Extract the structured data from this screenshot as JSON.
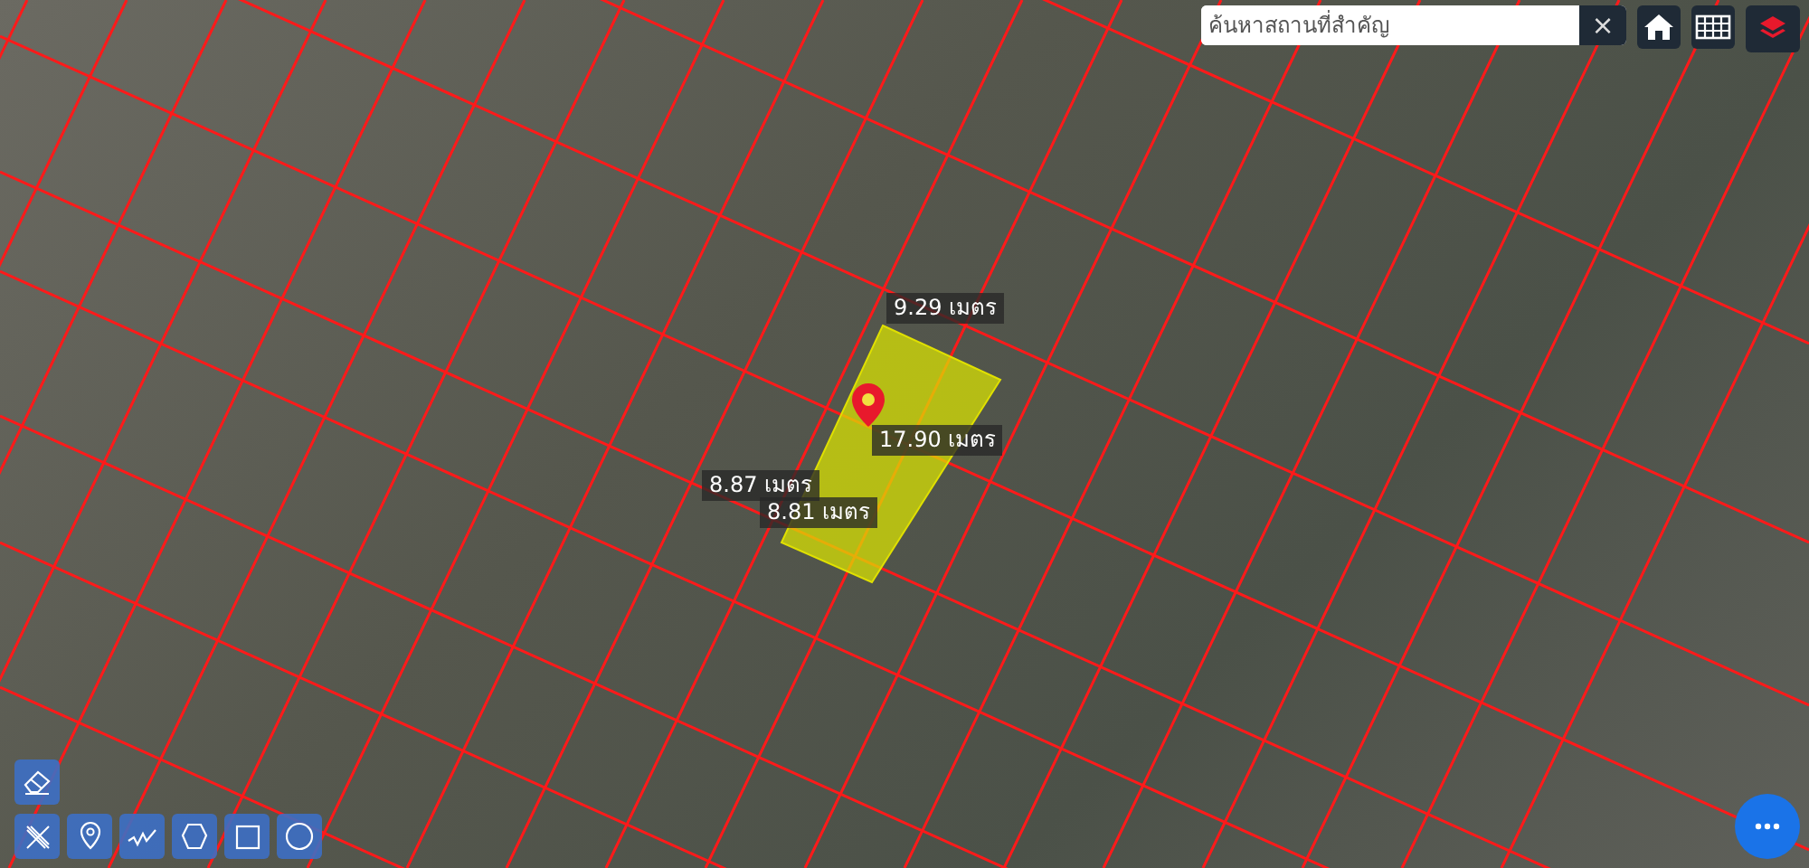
{
  "search": {
    "placeholder": "ค้นหาสถานที่สำคัญ",
    "clear": "×"
  },
  "measurements": [
    {
      "text": "9.29 เมตร"
    },
    {
      "text": "17.90 เมตร"
    },
    {
      "text": "8.87 เมตร"
    },
    {
      "text": "8.81 เมตร"
    }
  ]
}
